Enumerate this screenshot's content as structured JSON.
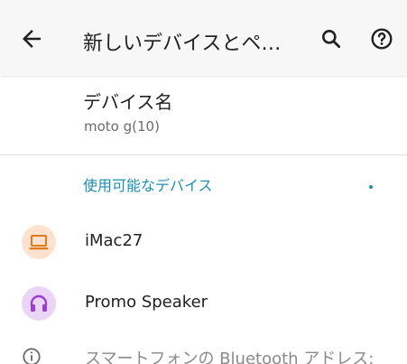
{
  "appbar": {
    "title": "新しいデバイスとペ…",
    "back_icon": "arrow-back-icon",
    "search_icon": "search-icon",
    "help_icon": "help-circle-icon"
  },
  "device_name": {
    "title": "デバイス名",
    "value": "moto g(10)"
  },
  "available_devices": {
    "header": "使用可能なデバイス",
    "items": [
      {
        "label": "iMac27",
        "icon": "laptop-icon",
        "icon_bg": "#fde3cf",
        "icon_color": "#e07b1a"
      },
      {
        "label": "Promo Speaker",
        "icon": "headphones-icon",
        "icon_bg": "#ead5f7",
        "icon_color": "#9b3fd1"
      }
    ]
  },
  "footer": {
    "text": "スマートフォンの Bluetooth アドレス:",
    "icon": "info-icon"
  },
  "colors": {
    "accent": "#1a8fb0",
    "appbar_bg": "#f7f7f7"
  }
}
